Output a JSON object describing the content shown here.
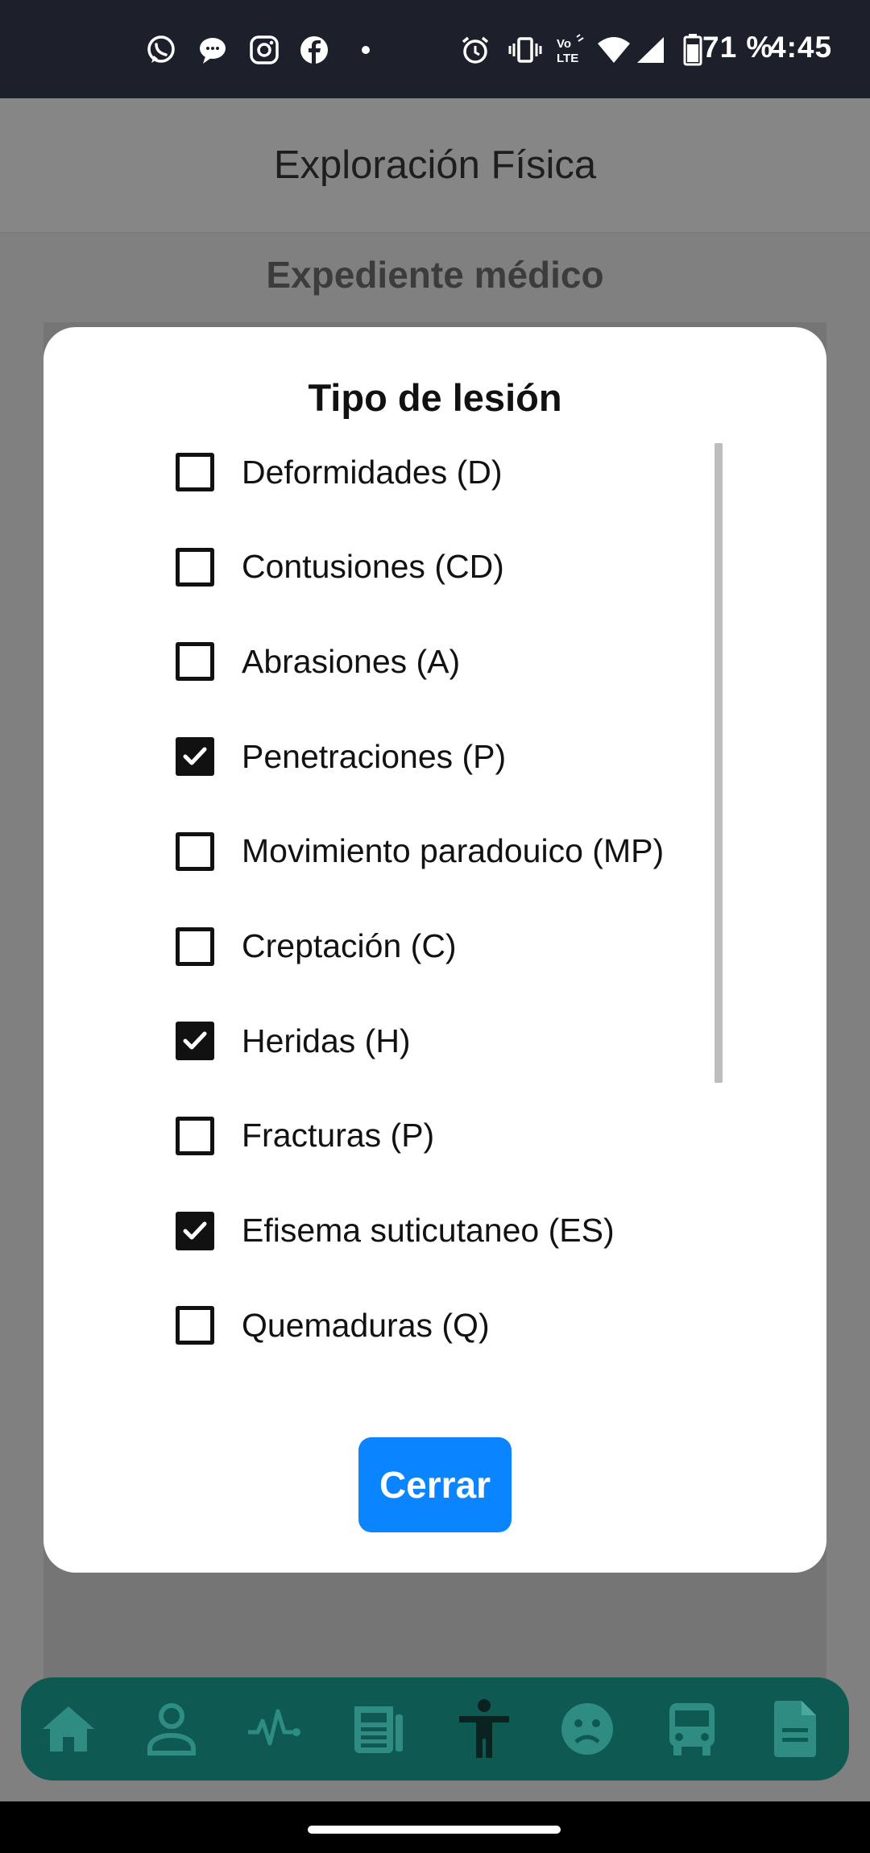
{
  "status_bar": {
    "battery": "71 %",
    "time": "4:45",
    "icons": [
      "whatsapp-icon",
      "messages-icon",
      "instagram-icon",
      "facebook-icon",
      "dot-icon",
      "alarm-icon",
      "vibrate-icon",
      "volte-icon",
      "wifi-icon",
      "signal-icon",
      "battery-icon"
    ]
  },
  "header": {
    "title": "Exploración Física"
  },
  "page": {
    "subtitle": "Expediente médico"
  },
  "modal": {
    "title": "Tipo de lesión",
    "options": [
      {
        "label": "Deformidades (D)",
        "checked": false
      },
      {
        "label": "Contusiones (CD)",
        "checked": false
      },
      {
        "label": "Abrasiones (A)",
        "checked": false
      },
      {
        "label": "Penetraciones (P)",
        "checked": true
      },
      {
        "label": "Movimiento paradouico (MP)",
        "checked": false
      },
      {
        "label": "Creptación (C)",
        "checked": false
      },
      {
        "label": "Heridas (H)",
        "checked": true
      },
      {
        "label": "Fracturas (P)",
        "checked": false
      },
      {
        "label": "Efisema suticutaneo (ES)",
        "checked": true
      },
      {
        "label": "Quemaduras (Q)",
        "checked": false
      }
    ],
    "close_label": "Cerrar"
  },
  "bottom_nav": {
    "items": [
      "home-icon",
      "user-icon",
      "vitals-icon",
      "news-icon",
      "body-icon",
      "sad-face-icon",
      "bus-icon",
      "document-icon"
    ],
    "active": "body-icon"
  },
  "colors": {
    "accent": "#0a84ff",
    "nav_bg": "#0e5a52",
    "status_bar": "#1b202a"
  }
}
